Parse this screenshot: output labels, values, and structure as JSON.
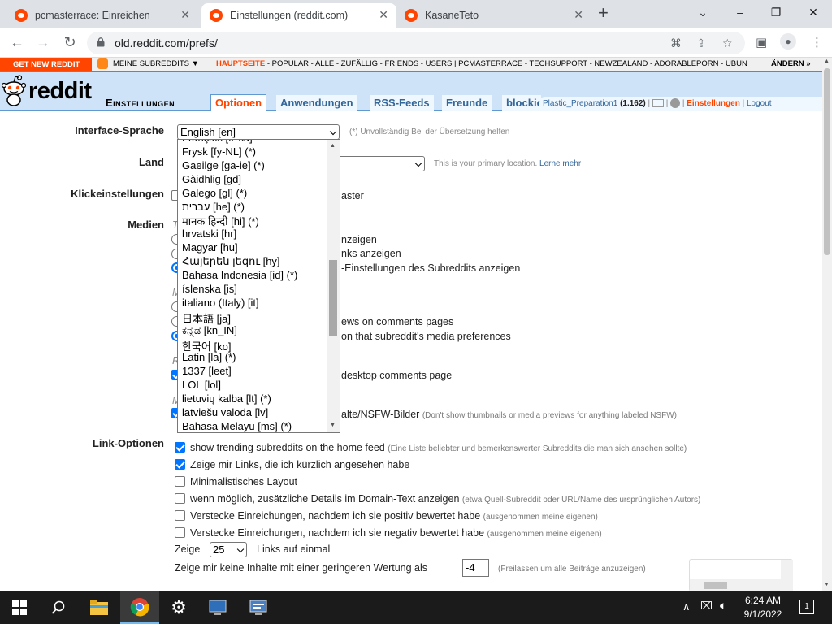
{
  "browser": {
    "tabs": [
      {
        "title": "pcmasterrace: Einreichen"
      },
      {
        "title": "Einstellungen (reddit.com)"
      },
      {
        "title": "KasaneTeto"
      }
    ],
    "new_tab": "+",
    "url": "old.reddit.com/prefs/"
  },
  "reddit_bar": {
    "get_new": "GET NEW REDDIT",
    "my_subreddits": "MEINE SUBREDDITS",
    "home": "HAUPTSEITE",
    "links": "- POPULAR - ALLE - ZUFÄLLIG - FRIENDS - USERS  |  PCMASTERRACE - TECHSUPPORT - NEWZEALAND - ADORABLEPORN - UBUN",
    "edit": "ÄNDERN »"
  },
  "header": {
    "logo": "reddit",
    "page_name": "Einstellungen",
    "tabs": [
      "Optionen",
      "Anwendungen",
      "RSS-Feeds",
      "Freunde",
      "blockie"
    ],
    "username": "Plastic_Preparation1",
    "karma": "(1.162)",
    "settings": "Einstellungen",
    "logout": "Logout"
  },
  "prefs": {
    "interface_language_label": "Interface-Sprache",
    "interface_language_value": "English [en]",
    "incomplete_note": "(*) Unvollständig",
    "help_translate": "Bei der Übersetzung helfen",
    "country_label": "Land",
    "country_hint": "This is your primary location.",
    "learn_more": "Lerne mehr",
    "click_label": "Klickeinstellungen",
    "click_option_tail": "aster",
    "media_label": "Medien",
    "media_option1_tail": "nzeigen",
    "media_option2_tail": "nks anzeigen",
    "media_option3_tail": "-Einstellungen des Subreddits anzeigen",
    "media_option4_tail": "ews on comments pages",
    "media_option5_tail": "on that subreddit's media preferences",
    "desktop_comments_tail": "desktop comments page",
    "nsfw_tail": "alte/NSFW-Bilder",
    "nsfw_note": "(Don't show thumbnails or media previews for anything labeled NSFW)",
    "link_options_label": "Link-Optionen",
    "link_options": [
      {
        "label": "show trending subreddits on the home feed",
        "note": "(Eine Liste beliebter und bemerkenswerter Subreddits die man sich ansehen sollte)",
        "checked": true
      },
      {
        "label": "Zeige mir Links, die ich kürzlich angesehen habe",
        "note": "",
        "checked": true
      },
      {
        "label": "Minimalistisches Layout",
        "note": "",
        "checked": false
      },
      {
        "label": "wenn möglich, zusätzliche Details im Domain-Text anzeigen",
        "note": "(etwa Quell-Subreddit oder URL/Name des ursprünglichen Autors)",
        "checked": false
      },
      {
        "label": "Verstecke Einreichungen, nachdem ich sie positiv bewertet habe",
        "note": "(ausgenommen meine eigenen)",
        "checked": false
      },
      {
        "label": "Verstecke Einreichungen, nachdem ich sie negativ bewertet habe",
        "note": "(ausgenommen meine eigenen)",
        "checked": false
      }
    ],
    "show_label": "Zeige",
    "show_count": "25",
    "links_at_once": "Links auf einmal",
    "min_score_label": "Zeige mir keine Inhalte mit einer geringeren Wertung als",
    "min_score_value": "-4",
    "min_score_note": "(Freilassen um alle Beiträge anzuzeigen)"
  },
  "language_dropdown": [
    "Français [fr-ca]",
    "Frysk [fy-NL] (*)",
    "Gaeilge [ga-ie] (*)",
    "Gàidhlig [gd]",
    "Galego [gl] (*)",
    "עברית [he] (*)",
    "मानक हिन्दी [hi] (*)",
    "hrvatski [hr]",
    "Magyar [hu]",
    "Հայերեն լեզու [hy]",
    "Bahasa Indonesia [id] (*)",
    "íslenska [is]",
    "italiano (Italy) [it]",
    "日本語 [ja]",
    "ಕನ್ನಡ [kn_IN]",
    "한국어 [ko]",
    "Latin [la] (*)",
    "1337 [leet]",
    "LOL [lol]",
    "lietuvių kalba [lt] (*)",
    "latviešu valoda [lv]",
    "Bahasa Melayu [ms] (*)"
  ],
  "taskbar": {
    "time": "6:24 AM",
    "date": "9/1/2022",
    "notifications": "1"
  },
  "colors": {
    "reddit_orange": "#ff4500",
    "header_blue": "#cee3f8",
    "link_blue": "#336699",
    "checkbox_blue": "#0075ff"
  }
}
